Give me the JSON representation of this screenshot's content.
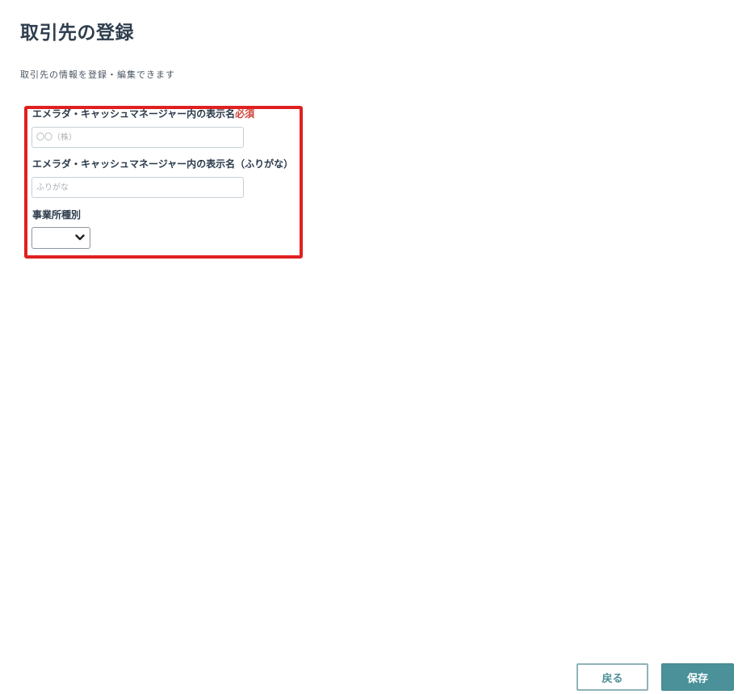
{
  "page": {
    "title": "取引先の登録",
    "description": "取引先の情報を登録・編集できます"
  },
  "form": {
    "display_name": {
      "label": "エメラダ・キャッシュマネージャー内の表示名",
      "required_label": "必須",
      "placeholder": "〇〇（株）",
      "value": ""
    },
    "display_name_kana": {
      "label": "エメラダ・キャッシュマネージャー内の表示名（ふりがな）",
      "placeholder": "ふりがな",
      "value": ""
    },
    "office_type": {
      "label": "事業所種別",
      "selected_value": ""
    }
  },
  "footer": {
    "back_label": "戻る",
    "save_label": "保存"
  },
  "colors": {
    "highlight": "#e02020",
    "required": "#d0453a",
    "primary": "#4a9199"
  }
}
